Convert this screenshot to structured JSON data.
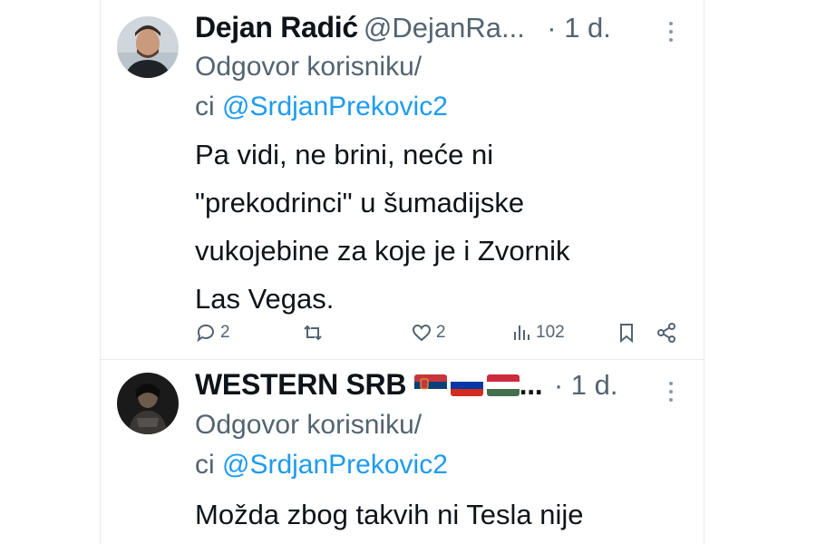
{
  "tweets": [
    {
      "author_name": "Dejan Radić",
      "handle": "@DejanRa...",
      "time": "· 1 d.",
      "reply_prefix_1": "Odgovor korisniku/",
      "reply_prefix_2": "ci ",
      "reply_mention": "@SrdjanPrekovic2",
      "text_lines": [
        "Pa vidi, ne brini, neće ni",
        "\"prekodrinci\" u šumadijske",
        "vukojebine za koje je i Zvornik",
        "Las Vegas."
      ],
      "replies": "2",
      "retweets": "",
      "likes": "2",
      "views": "102"
    },
    {
      "author_name": "WESTERN SRB",
      "name_suffix": "...",
      "flags": [
        "serbia-flag",
        "russia-flag",
        "hungary-flag"
      ],
      "time": "· 1 d.",
      "reply_prefix_1": "Odgovor korisniku/",
      "reply_prefix_2": "ci ",
      "reply_mention": "@SrdjanPrekovic2",
      "text_lines": [
        "Možda zbog takvih ni Tesla nije"
      ]
    }
  ],
  "colors": {
    "text": "#0f1419",
    "secondary": "#536471",
    "link": "#1d9bf0",
    "divider": "#e7e9ea"
  }
}
